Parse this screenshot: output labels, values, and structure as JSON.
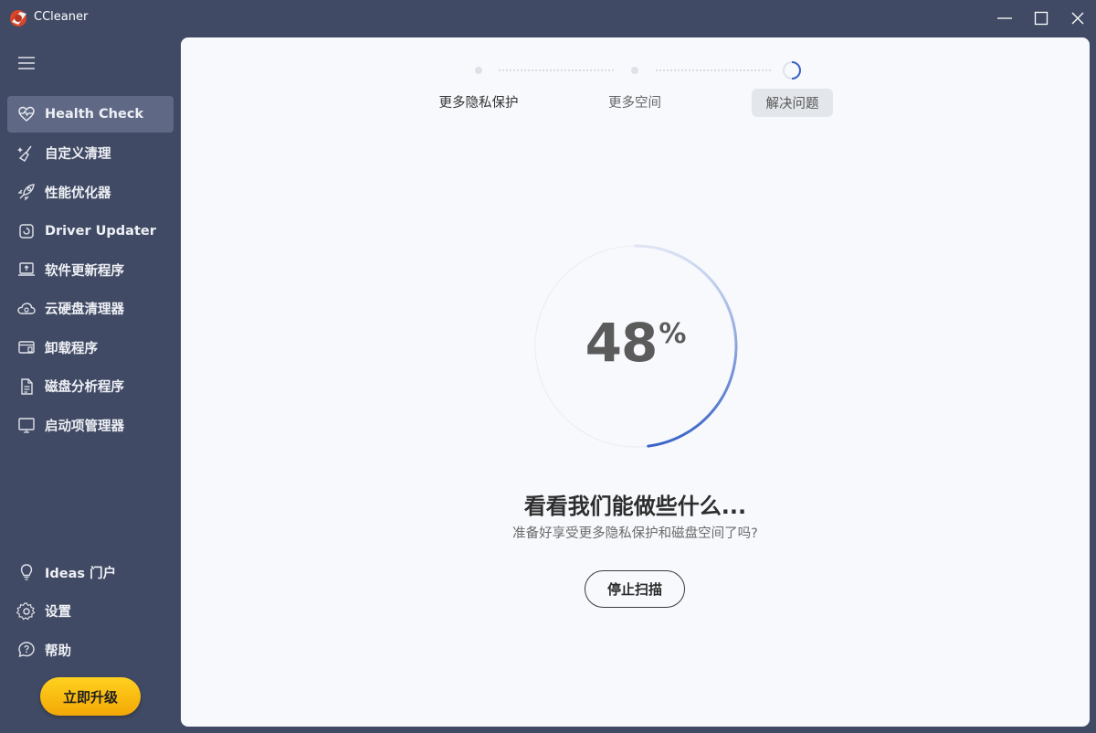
{
  "app": {
    "title": "CCleaner"
  },
  "sidebar": {
    "items": [
      {
        "label": "Health Check",
        "icon": "heart-pulse-icon",
        "active": true
      },
      {
        "label": "自定义清理",
        "icon": "broom-icon"
      },
      {
        "label": "性能优化器",
        "icon": "rocket-icon"
      },
      {
        "label": "Driver Updater",
        "icon": "driver-chip-icon"
      },
      {
        "label": "软件更新程序",
        "icon": "software-update-icon"
      },
      {
        "label": "云硬盘清理器",
        "icon": "cloud-cleaner-icon"
      },
      {
        "label": "卸载程序",
        "icon": "uninstall-icon"
      },
      {
        "label": "磁盘分析程序",
        "icon": "disk-analyzer-icon"
      },
      {
        "label": "启动项管理器",
        "icon": "startup-monitor-icon"
      }
    ],
    "bottom_items": [
      {
        "label": "Ideas 门户",
        "icon": "lightbulb-icon"
      },
      {
        "label": "设置",
        "icon": "gear-icon"
      },
      {
        "label": "帮助",
        "icon": "help-icon"
      }
    ],
    "upgrade_label": "立即升级"
  },
  "stepper": {
    "steps": [
      {
        "label": "更多隐私保护",
        "state": "done"
      },
      {
        "label": "更多空间",
        "state": "done"
      },
      {
        "label": "解决问题",
        "state": "in-progress"
      }
    ]
  },
  "scan": {
    "progress_value": "48",
    "progress_unit": "%",
    "progress_fraction": 0.48,
    "headline": "看看我们能做些什么...",
    "subline": "准备好享受更多隐私保护和磁盘空间了吗?",
    "stop_label": "停止扫描"
  },
  "colors": {
    "sidebar_bg": "#414a64",
    "active_item": "#5f6986",
    "panel_bg": "#f7f9fd",
    "progress_accent": "#3a63c8",
    "upgrade_yellow": "#f9be12"
  }
}
